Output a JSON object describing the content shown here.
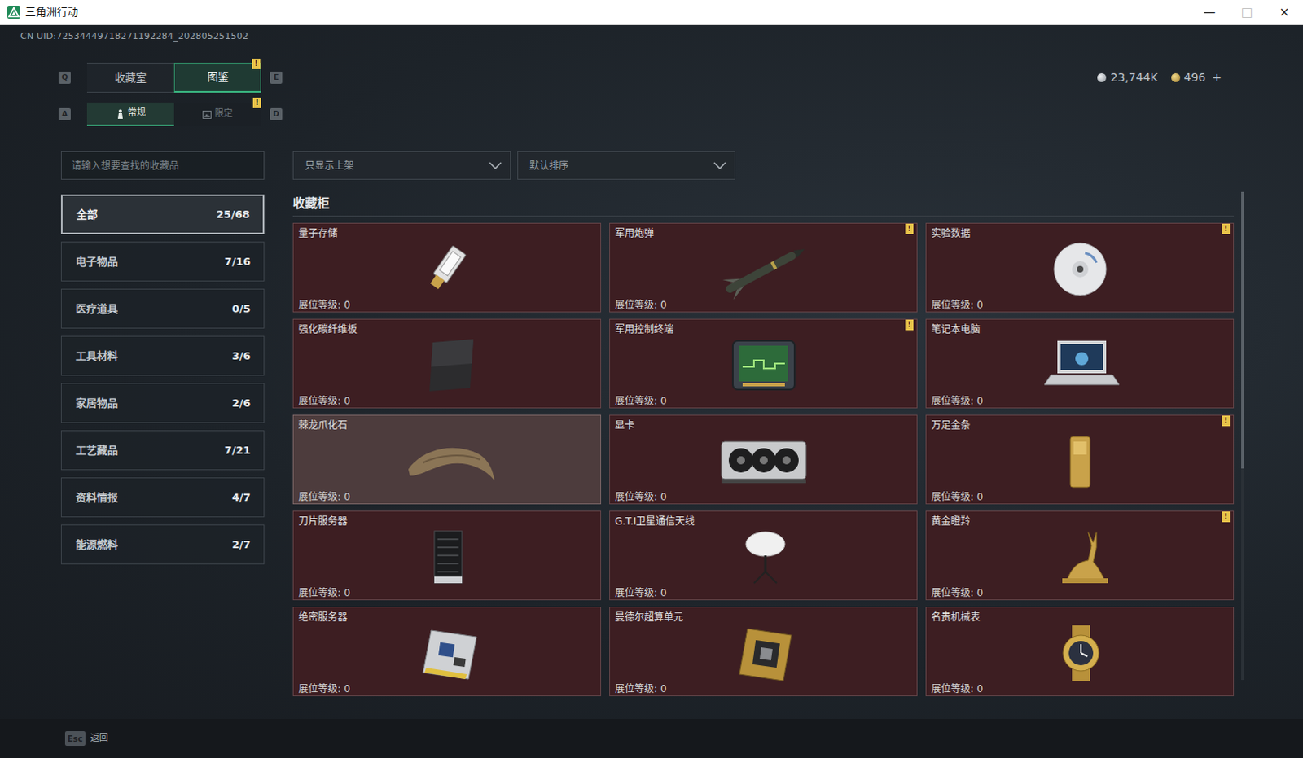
{
  "window": {
    "title": "三角洲行动",
    "controls": [
      "—",
      "□",
      "×"
    ]
  },
  "uid": "CN UID:72534449718271192284_202805251502",
  "alert_glyph": "!",
  "currency": {
    "silver": "23,744K",
    "gold": "496",
    "add": "+"
  },
  "tabs": {
    "prev_key": "Q",
    "next_key": "E",
    "items": [
      {
        "label": "收藏室",
        "selected": false,
        "alert": false
      },
      {
        "label": "图鉴",
        "selected": true,
        "alert": true
      }
    ]
  },
  "subtabs": {
    "prev_key": "A",
    "next_key": "D",
    "items": [
      {
        "label": "常规",
        "selected": true,
        "alert": false
      },
      {
        "label": "限定",
        "selected": false,
        "alert": true
      }
    ]
  },
  "search": {
    "placeholder": "请输入想要查找的收藏品"
  },
  "filters": [
    {
      "label": "只显示上架"
    },
    {
      "label": "默认排序"
    }
  ],
  "categories": [
    {
      "label": "全部",
      "count": "25/68",
      "selected": true
    },
    {
      "label": "电子物品",
      "count": "7/16",
      "selected": false
    },
    {
      "label": "医疗道具",
      "count": "0/5",
      "selected": false
    },
    {
      "label": "工具材料",
      "count": "3/6",
      "selected": false
    },
    {
      "label": "家居物品",
      "count": "2/6",
      "selected": false
    },
    {
      "label": "工艺藏品",
      "count": "7/21",
      "selected": false
    },
    {
      "label": "资料情报",
      "count": "4/7",
      "selected": false
    },
    {
      "label": "能源燃料",
      "count": "2/7",
      "selected": false
    }
  ],
  "cabinet": {
    "title": "收藏柜",
    "booth_label": "展位等级:",
    "items": [
      {
        "name": "量子存储",
        "booth": "0",
        "alert": false,
        "hovered": false
      },
      {
        "name": "军用炮弹",
        "booth": "0",
        "alert": true,
        "hovered": false
      },
      {
        "name": "实验数据",
        "booth": "0",
        "alert": true,
        "hovered": false
      },
      {
        "name": "强化碳纤维板",
        "booth": "0",
        "alert": false,
        "hovered": false
      },
      {
        "name": "军用控制终端",
        "booth": "0",
        "alert": true,
        "hovered": false
      },
      {
        "name": "笔记本电脑",
        "booth": "0",
        "alert": false,
        "hovered": false
      },
      {
        "name": "棘龙爪化石",
        "booth": "0",
        "alert": false,
        "hovered": true
      },
      {
        "name": "显卡",
        "booth": "0",
        "alert": false,
        "hovered": false
      },
      {
        "name": "万足金条",
        "booth": "0",
        "alert": true,
        "hovered": false
      },
      {
        "name": "刀片服务器",
        "booth": "0",
        "alert": false,
        "hovered": false
      },
      {
        "name": "G.T.I卫星通信天线",
        "booth": "0",
        "alert": false,
        "hovered": false
      },
      {
        "name": "黄金瞪羚",
        "booth": "0",
        "alert": true,
        "hovered": false
      },
      {
        "name": "绝密服务器",
        "booth": "0",
        "alert": false,
        "hovered": false
      },
      {
        "name": "曼德尔超算单元",
        "booth": "0",
        "alert": false,
        "hovered": false
      },
      {
        "name": "名贵机械表",
        "booth": "0",
        "alert": false,
        "hovered": false
      }
    ]
  },
  "footer": {
    "key": "Esc",
    "label": "返回"
  }
}
